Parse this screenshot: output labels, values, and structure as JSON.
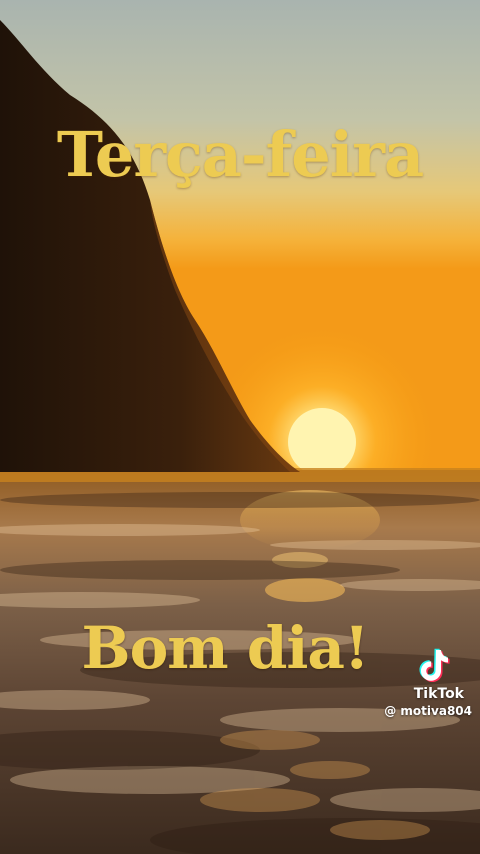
{
  "overlay": {
    "title": "Terça-feira",
    "greeting": "Bom dia!"
  },
  "watermark": {
    "brand": "TikTok",
    "handle": "@ motiva804",
    "icon": "tiktok-logo-icon"
  },
  "colors": {
    "text_gold": "#EDCB52",
    "sky_top": "#A9B4AF",
    "sky_horizon": "#F6A21E",
    "sun": "#FFF4B0",
    "cliff": "#2E1A0C",
    "sea": "#6B4A2E"
  }
}
